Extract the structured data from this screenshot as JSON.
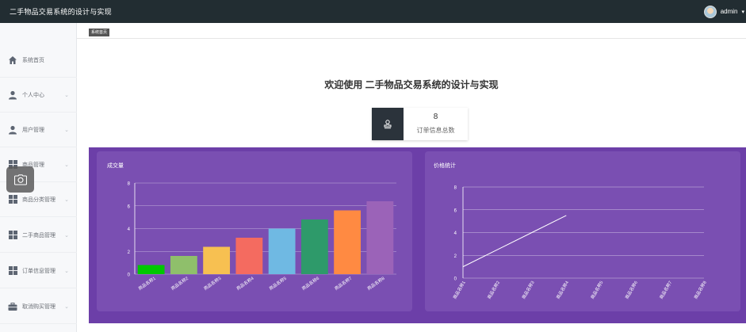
{
  "header": {
    "title": "二手物品交易系统的设计与实现",
    "user": "admin",
    "caret": "▾"
  },
  "sidebar": {
    "items": [
      {
        "label": "系统首页",
        "icon": "home-icon",
        "chevron": ""
      },
      {
        "label": "个人中心",
        "icon": "user-icon",
        "chevron": "⌄"
      },
      {
        "label": "用户管理",
        "icon": "user-icon",
        "chevron": "⌄"
      },
      {
        "label": "商品管理",
        "icon": "grid-icon",
        "chevron": "⌄"
      },
      {
        "label": "商品分类管理",
        "icon": "grid-icon",
        "chevron": "⌄"
      },
      {
        "label": "二手商品管理",
        "icon": "grid-icon",
        "chevron": "⌄"
      },
      {
        "label": "订单信息管理",
        "icon": "grid-icon",
        "chevron": "⌄"
      },
      {
        "label": "取消购买管理",
        "icon": "briefcase-icon",
        "chevron": "⌄"
      }
    ]
  },
  "breadcrumb": {
    "label": "系统首页"
  },
  "welcome": "欢迎使用 二手物品交易系统的设计与实现",
  "stat": {
    "value": "8",
    "label": "订单信息总数",
    "icon": "stamp-icon"
  },
  "colors": {
    "topbar": "#222d32",
    "panel_bg": "#6c3fa8",
    "panel": "#7a4fb2"
  },
  "chart_data": [
    {
      "type": "bar",
      "title": "成交量",
      "categories": [
        "商品名称1",
        "商品名称2",
        "商品名称3",
        "商品名称4",
        "商品名称5",
        "商品名称6",
        "商品名称7",
        "商品名称8"
      ],
      "values": [
        0.8,
        1.6,
        2.4,
        3.2,
        4.0,
        4.8,
        5.6,
        6.4
      ],
      "colors": [
        "#00c800",
        "#8fbf6b",
        "#f7c051",
        "#f46b60",
        "#6fb9e3",
        "#2e9a6a",
        "#ff8a42",
        "#9b63b8"
      ],
      "ylim": [
        0,
        8
      ],
      "yticks": [
        0,
        2,
        4,
        6,
        8
      ],
      "grid": true
    },
    {
      "type": "line",
      "title": "价格统计",
      "categories": [
        "商品名称1",
        "商品名称2",
        "商品名称3",
        "商品名称4",
        "商品名称5",
        "商品名称6",
        "商品名称7",
        "商品名称8"
      ],
      "values": [
        1,
        2.5,
        4,
        5.5
      ],
      "ylim": [
        0,
        8
      ],
      "yticks": [
        0,
        2,
        4,
        6,
        8
      ],
      "grid": true
    }
  ]
}
